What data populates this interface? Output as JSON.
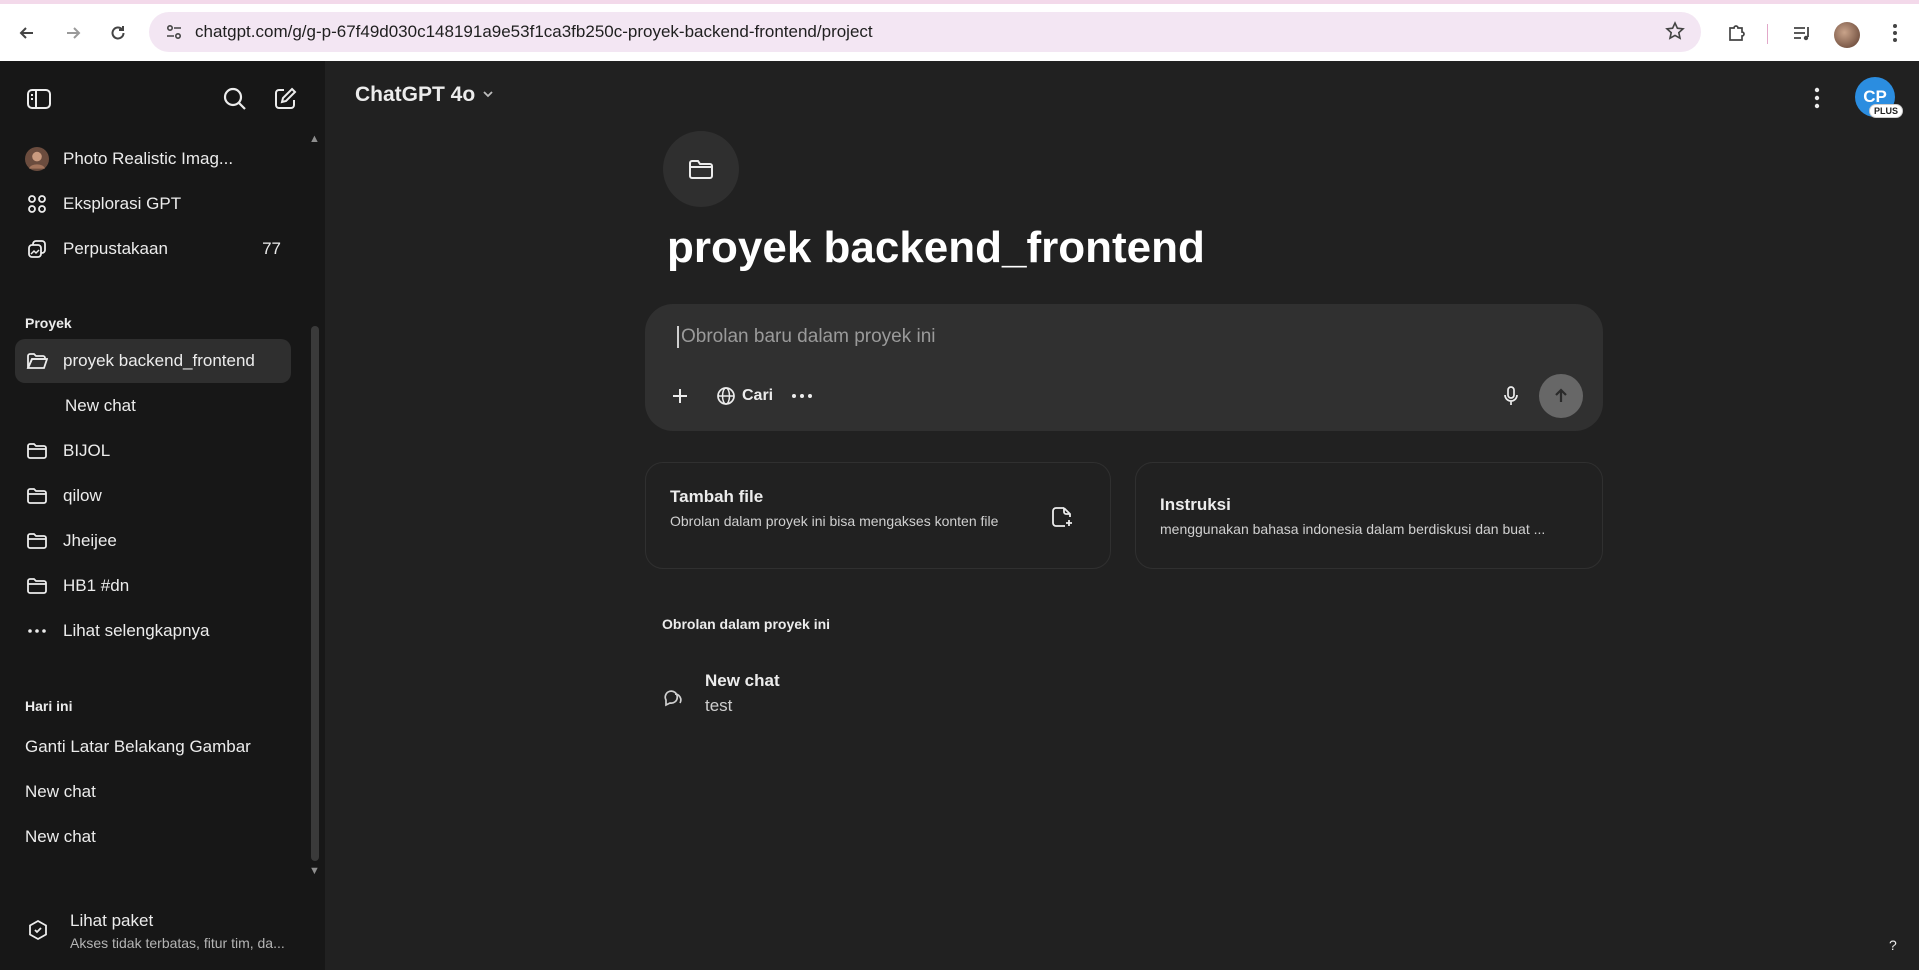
{
  "browser": {
    "url": "chatgpt.com/g/g-p-67f49d030c148191a9e53f1ca3fb250c-proyek-backend-frontend/project"
  },
  "sidebar": {
    "gpts": [
      {
        "label": "Photo Realistic Imag...",
        "icon": "gpt-avatar"
      },
      {
        "label": "Eksplorasi GPT",
        "icon": "grid-icon"
      },
      {
        "label": "Perpustakaan",
        "icon": "library-icon",
        "count": "77"
      }
    ],
    "projects_heading": "Proyek",
    "projects": [
      {
        "label": "proyek backend_frontend",
        "icon": "folder-open-icon",
        "active": true
      },
      {
        "label": "New chat",
        "icon": "",
        "child": true
      },
      {
        "label": "BIJOL",
        "icon": "folder-icon"
      },
      {
        "label": "qilow",
        "icon": "folder-icon"
      },
      {
        "label": "Jheijee",
        "icon": "folder-icon"
      },
      {
        "label": "HB1 #dn",
        "icon": "folder-icon"
      },
      {
        "label": "Lihat selengkapnya",
        "icon": "ellipsis-icon"
      }
    ],
    "today_heading": "Hari ini",
    "today": [
      "Ganti Latar Belakang Gambar",
      "New chat",
      "New chat"
    ],
    "plan": {
      "title": "Lihat paket",
      "subtitle": "Akses tidak terbatas, fitur tim, da..."
    }
  },
  "header": {
    "model": "ChatGPT 4o",
    "avatar_initials": "CP",
    "badge": "PLUS"
  },
  "project": {
    "title": "proyek backend_frontend",
    "composer": {
      "placeholder": "Obrolan baru dalam proyek ini",
      "search_label": "Cari"
    },
    "cards": [
      {
        "title": "Tambah file",
        "desc": "Obrolan dalam proyek ini bisa mengakses konten file"
      },
      {
        "title": "Instruksi",
        "desc": "menggunakan bahasa indonesia dalam berdiskusi dan buat ..."
      }
    ],
    "conversations_heading": "Obrolan dalam proyek ini",
    "conversations": [
      {
        "title": "New chat",
        "snippet": "test"
      }
    ]
  },
  "help": "?",
  "colors": {
    "sidebar_bg": "#171717",
    "main_bg": "#212121",
    "composer_bg": "#303030",
    "avatar": "#2b8de0"
  }
}
